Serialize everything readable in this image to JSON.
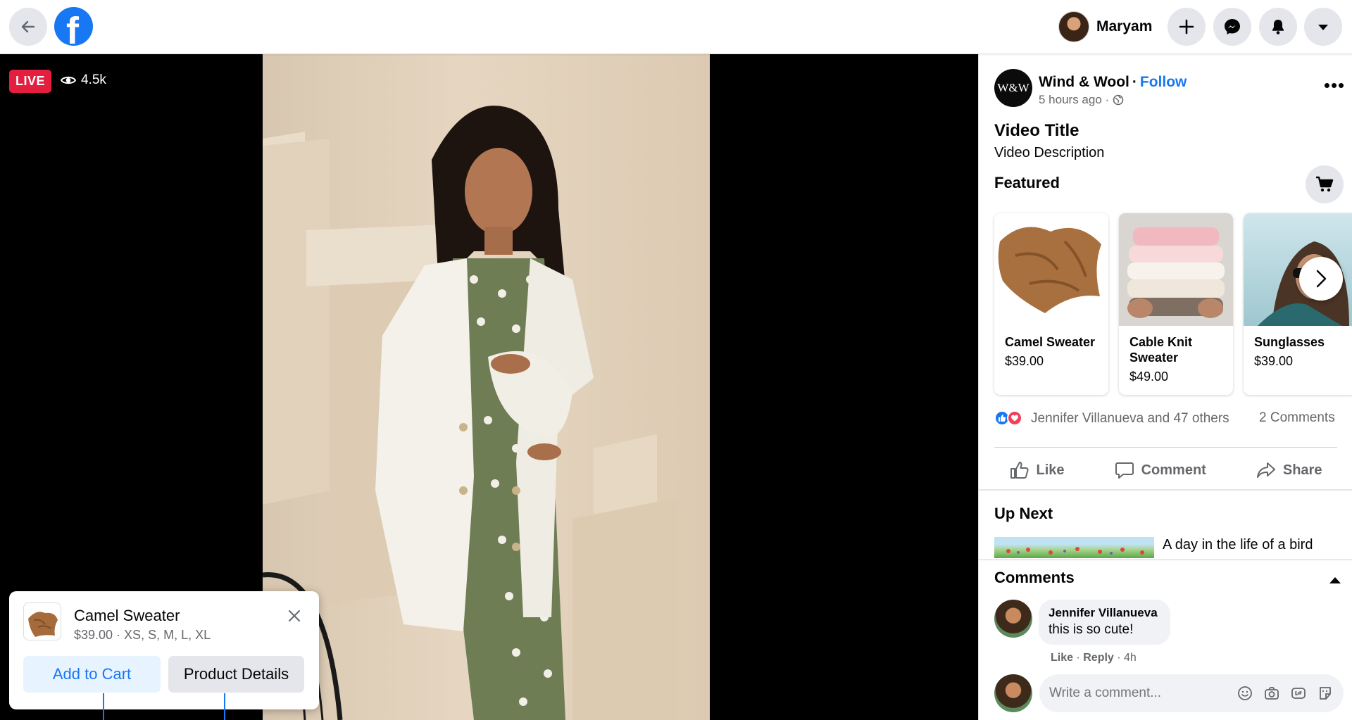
{
  "topbar": {
    "user_name": "Maryam"
  },
  "video": {
    "live_label": "LIVE",
    "viewer_count": "4.5k"
  },
  "product_card": {
    "title": "Camel Sweater",
    "subtitle": "$39.00 · XS, S, M, L, XL",
    "add_to_cart": "Add to Cart",
    "product_details": "Product Details"
  },
  "post": {
    "page_avatar_text": "W&W",
    "page_name": "Wind & Wool",
    "separator": "·",
    "follow_label": "Follow",
    "time": "5 hours ago ·",
    "more_label": "•••",
    "video_title": "Video Title",
    "video_description": "Video Description",
    "featured_label": "Featured"
  },
  "featured_items": [
    {
      "name": "Camel Sweater",
      "price": "$39.00"
    },
    {
      "name": "Cable Knit Sweater",
      "price": "$49.00"
    },
    {
      "name": "Sunglasses",
      "price": "$39.00"
    }
  ],
  "engagement": {
    "reactions_text": "Jennifer Villanueva and 47 others",
    "comments_count": "2 Comments",
    "like_label": "Like",
    "comment_label": "Comment",
    "share_label": "Share"
  },
  "up_next": {
    "title": "Up Next",
    "item_title": "A day in the life of a bird"
  },
  "comments": {
    "title": "Comments",
    "items": [
      {
        "author": "Jennifer Villanueva",
        "text": "this is so cute!",
        "like": "Like",
        "reply": "Reply",
        "time": "4h"
      }
    ],
    "write_placeholder": "Write a comment..."
  },
  "colors": {
    "brand": "#1877f2",
    "live": "#e41e3f",
    "love": "#f33e58"
  },
  "icons": [
    "back-arrow-icon",
    "facebook-logo-icon",
    "plus-icon",
    "messenger-icon",
    "bell-icon",
    "caret-down-icon",
    "eye-icon",
    "close-icon",
    "globe-icon",
    "cart-icon",
    "chevron-right-icon",
    "like-icon",
    "comment-icon",
    "share-icon",
    "caret-up-icon",
    "emoji-icon",
    "camera-icon",
    "gif-icon",
    "sticker-icon"
  ]
}
